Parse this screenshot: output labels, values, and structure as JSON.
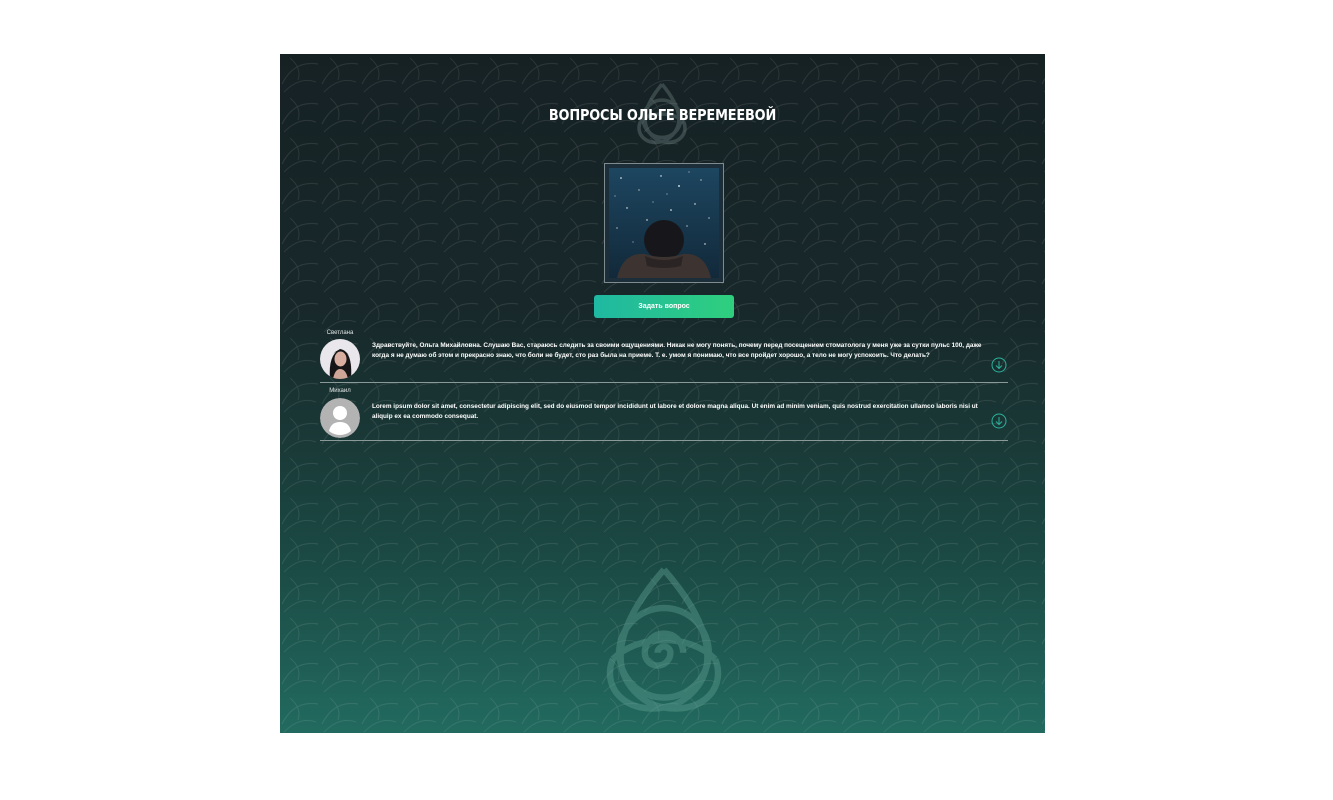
{
  "page": {
    "title": "ВОПРОСЫ ОЛЬГЕ ВЕРЕМЕЕВОЙ",
    "ask_button_label": "Задать вопрос"
  },
  "questions": [
    {
      "name": "Светлана",
      "text": "Здравствуйте, Ольга Михайловна. Слушаю Вас, стараюсь следить за своими ощущениями. Никак не могу понять, почему перед посещением стоматолога у меня уже за сутки пульс 100, даже когда я не думаю об этом и прекрасно знаю, что боли не будет, сто раз была на приеме. Т. е. умом я понимаю, что все пройдет хорошо, а тело не могу успокоить. Что делать?"
    },
    {
      "name": "Михаил",
      "text": "Lorem ipsum dolor sit amet, consectetur adipiscing elit, sed do eiusmod tempor incididunt ut labore et dolore magna aliqua. Ut enim ad minim veniam, quis nostrud exercitation ullamco laboris nisi ut aliquip ex ea commodo consequat."
    }
  ],
  "icons": {
    "expand": "chevron-down-circle-icon",
    "logo": "triquetra-knot-icon",
    "default_avatar": "user-placeholder-icon"
  },
  "colors": {
    "background_top": "#162124",
    "background_bottom": "#226a5f",
    "button_start": "#1fb8a2",
    "button_end": "#2fcf7e",
    "accent": "#2ab39c"
  }
}
